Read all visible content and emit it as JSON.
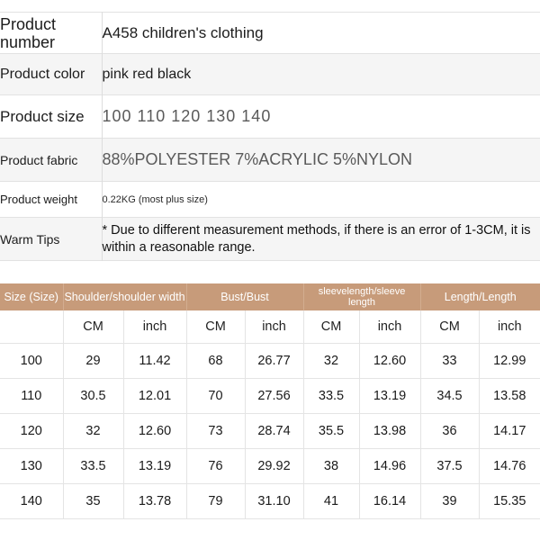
{
  "spec": {
    "rows": [
      {
        "label": "Product number",
        "value": "A458 children's clothing"
      },
      {
        "label": "Product color",
        "value": "pink red black"
      },
      {
        "label": "Product size",
        "value": "100  110  120  130  140"
      },
      {
        "label": "Product fabric",
        "value": "88%POLYESTER  7%ACRYLIC  5%NYLON"
      },
      {
        "label": "Product weight",
        "value": "0.22KG (most plus size)"
      },
      {
        "label": "Warm Tips",
        "value": "* Due to different measurement methods, if there is an error of 1-3CM, it is within a reasonable range."
      }
    ]
  },
  "size_chart": {
    "group_headers": [
      "Size (Size)",
      "Shoulder/shoulder width",
      "Bust/Bust",
      "sleevelength/sleeve length",
      "Length/Length"
    ],
    "unit_row": [
      "",
      "CM",
      "inch",
      "CM",
      "inch",
      "CM",
      "inch",
      "CM",
      "inch"
    ],
    "rows": [
      {
        "size": "100",
        "shoulder_cm": "29",
        "shoulder_in": "11.42",
        "bust_cm": "68",
        "bust_in": "26.77",
        "sleeve_cm": "32",
        "sleeve_in": "12.60",
        "length_cm": "33",
        "length_in": "12.99"
      },
      {
        "size": "110",
        "shoulder_cm": "30.5",
        "shoulder_in": "12.01",
        "bust_cm": "70",
        "bust_in": "27.56",
        "sleeve_cm": "33.5",
        "sleeve_in": "13.19",
        "length_cm": "34.5",
        "length_in": "13.58"
      },
      {
        "size": "120",
        "shoulder_cm": "32",
        "shoulder_in": "12.60",
        "bust_cm": "73",
        "bust_in": "28.74",
        "sleeve_cm": "35.5",
        "sleeve_in": "13.98",
        "length_cm": "36",
        "length_in": "14.17"
      },
      {
        "size": "130",
        "shoulder_cm": "33.5",
        "shoulder_in": "13.19",
        "bust_cm": "76",
        "bust_in": "29.92",
        "sleeve_cm": "38",
        "sleeve_in": "14.96",
        "length_cm": "37.5",
        "length_in": "14.76"
      },
      {
        "size": "140",
        "shoulder_cm": "35",
        "shoulder_in": "13.78",
        "bust_cm": "79",
        "bust_in": "31.10",
        "sleeve_cm": "41",
        "sleeve_in": "16.14",
        "length_cm": "39",
        "length_in": "15.35"
      }
    ]
  },
  "colors": {
    "header_band": "#c79b7a",
    "row_tint": "#f5f5f5",
    "border": "#e2e2e2",
    "text_dark": "#1c1c1c",
    "text_muted": "#5a5a5a"
  }
}
